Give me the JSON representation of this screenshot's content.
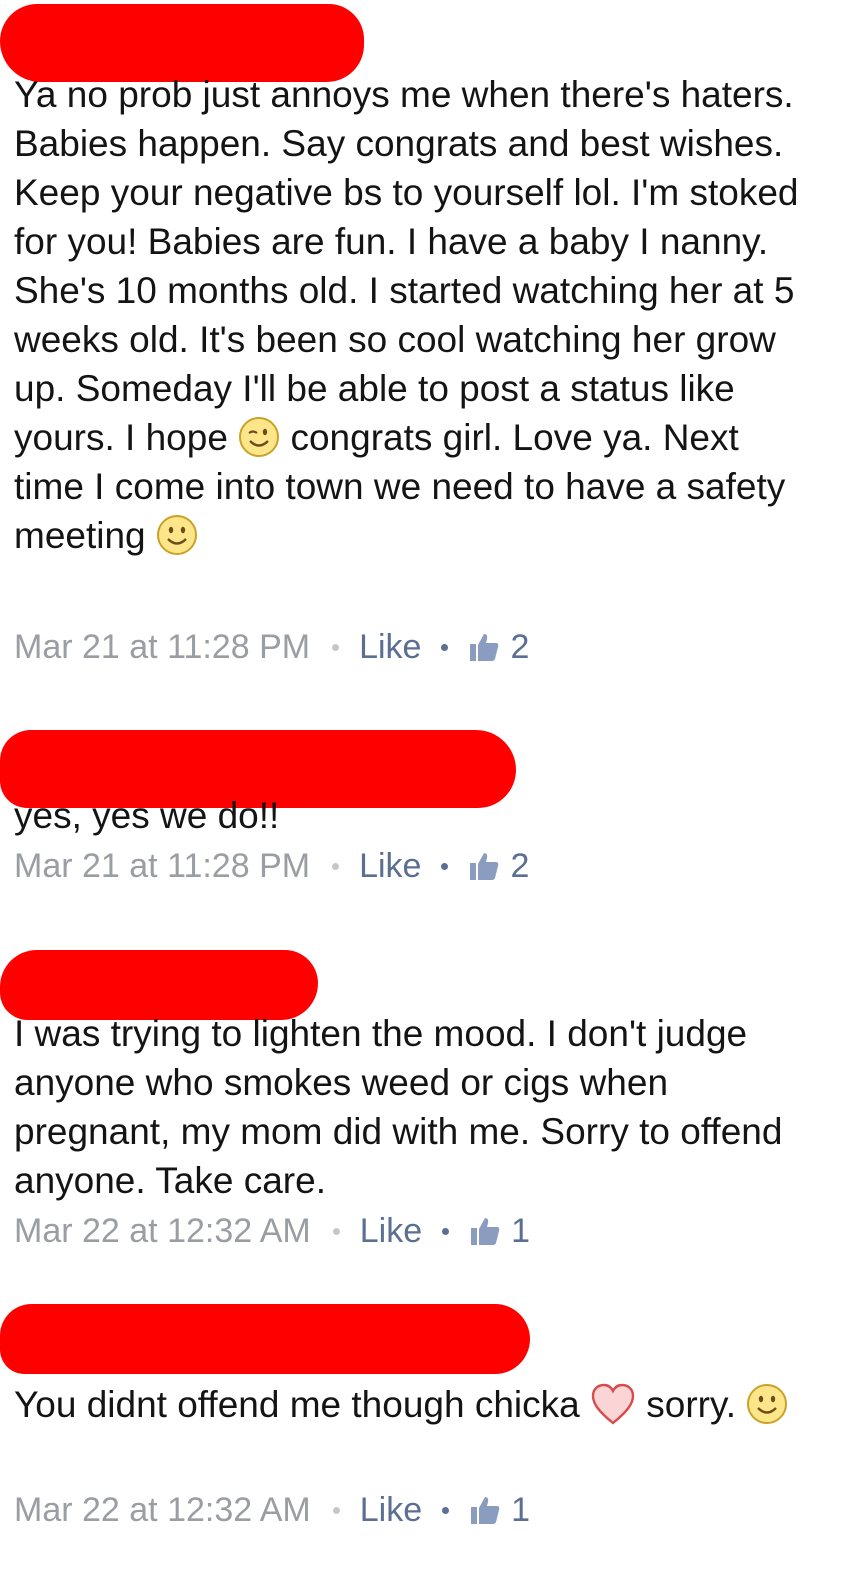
{
  "comments": [
    {
      "text_before": "Ya no prob just annoys me when there's haters. Babies happen. Say congrats and best wishes. Keep your negative bs to yourself lol. I'm stoked for you! Babies are fun. I have a baby I nanny. She's 10 months old. I started watching her at 5 weeks old. It's been so cool watching her grow up. Someday I'll be able to post a status like yours. I hope ",
      "emoji1": "wink-emoji",
      "text_middle": " congrats girl. Love ya. Next time I come into town we need to have a safety meeting ",
      "emoji2": "smile-emoji",
      "timestamp": "Mar 21 at 11:28 PM",
      "like_label": "Like",
      "like_count": "2"
    },
    {
      "text": "yes, yes we do!!",
      "timestamp": "Mar 21 at 11:28 PM",
      "like_label": "Like",
      "like_count": "2"
    },
    {
      "text": "I was trying to lighten the mood. I don't judge anyone who smokes weed or cigs when pregnant, my mom did with me. Sorry to offend anyone. Take care.",
      "timestamp": "Mar 22 at 12:32 AM",
      "like_label": "Like",
      "like_count": "1"
    },
    {
      "text_before": "You didnt offend me though chicka ",
      "heart": "heart-icon",
      "text_after": " sorry. ",
      "emoji": "smile-emoji",
      "timestamp": "Mar 22 at 12:32 AM",
      "like_label": "Like",
      "like_count": "1"
    }
  ],
  "colors": {
    "redaction": "#ff0000",
    "body_text": "#141414",
    "timestamp": "#9a9da2",
    "link": "#5b6f93"
  }
}
